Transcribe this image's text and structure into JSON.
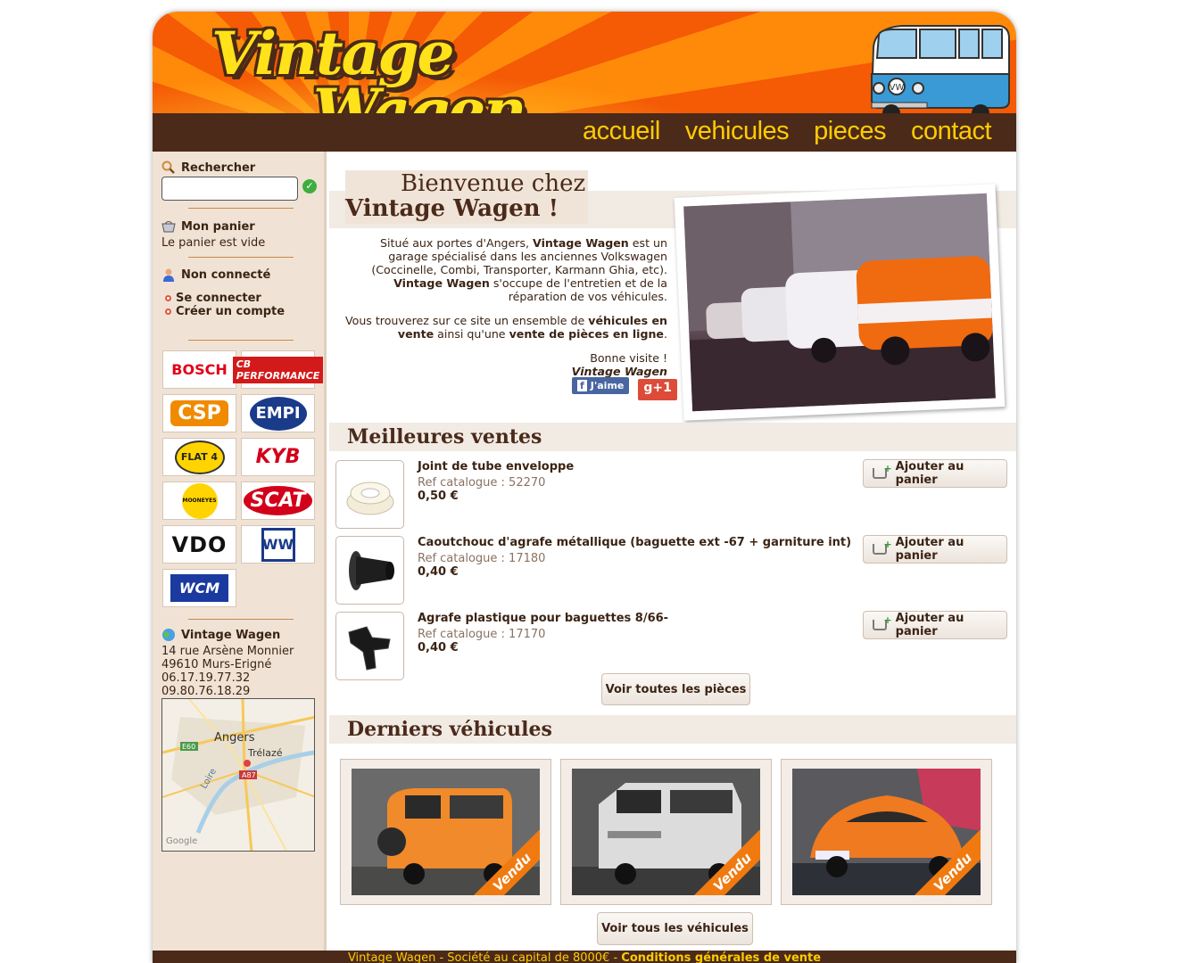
{
  "header": {
    "logo_line1": "Vintage",
    "logo_line2": "Wagen",
    "nav": [
      "accueil",
      "vehicules",
      "pieces",
      "contact"
    ]
  },
  "sidebar": {
    "search_title": "Rechercher",
    "search_value": "",
    "cart_title": "Mon panier",
    "cart_text": "Le panier est vide",
    "user_title": "Non connecté",
    "login_label": "Se connecter",
    "register_label": "Créer un compte",
    "brands": [
      "BOSCH",
      "CB PERFORMANCE",
      "CSP",
      "EMPI",
      "FLAT 4",
      "KYB",
      "MOONEYES",
      "SCAT",
      "VDO",
      "WW",
      "WCM"
    ],
    "contact_title": "Vintage Wagen",
    "address1": "14 rue Arsène Monnier",
    "address2": "49610 Murs-Erigné",
    "phone1": "06.17.19.77.32",
    "phone2": "09.80.76.18.29",
    "map_labels": {
      "city1": "Angers",
      "city2": "Trélazé",
      "road1": "E60",
      "road2": "A87",
      "river": "Loire",
      "credit": "Google"
    }
  },
  "welcome": {
    "line1": "Bienvenue chez",
    "line2": "Vintage Wagen !",
    "p1_a": "Situé aux portes d'Angers, ",
    "p1_b": "Vintage Wagen",
    "p1_c": " est un garage spécialisé dans les anciennes Volkswagen (Coccinelle, Combi, Transporter, Karmann Ghia, etc). ",
    "p1_d": "Vintage Wagen",
    "p1_e": " s'occupe de l'entretien et de la réparation de vos véhicules.",
    "p2_a": "Vous trouverez sur ce site un ensemble de ",
    "p2_b": "véhicules en vente",
    "p2_c": " ainsi qu'une ",
    "p2_d": "vente de pièces en ligne",
    "p2_e": ".",
    "p3": "Bonne visite !",
    "p4": "Vintage Wagen",
    "fb_like": "J'aime",
    "gplus": "g+1"
  },
  "bestsellers": {
    "title": "Meilleures ventes",
    "ref_label": "Ref catalogue : ",
    "add_label": "Ajouter au panier",
    "items": [
      {
        "name": "Joint de tube enveloppe",
        "ref": "52270",
        "price": "0,50 €"
      },
      {
        "name": "Caoutchouc d'agrafe métallique (baguette ext -67 + garniture int)",
        "ref": "17180",
        "price": "0,40 €"
      },
      {
        "name": "Agrafe plastique pour baguettes 8/66-",
        "ref": "17170",
        "price": "0,40 €"
      }
    ],
    "all_parts_label": "Voir toutes les pièces"
  },
  "vehicles": {
    "title": "Derniers véhicules",
    "sold_label": "Vendu",
    "all_label": "Voir tous les véhicules"
  },
  "footer": {
    "text": "Vintage Wagen - Société au capital de 8000€ - ",
    "link": "Conditions générales de vente"
  }
}
